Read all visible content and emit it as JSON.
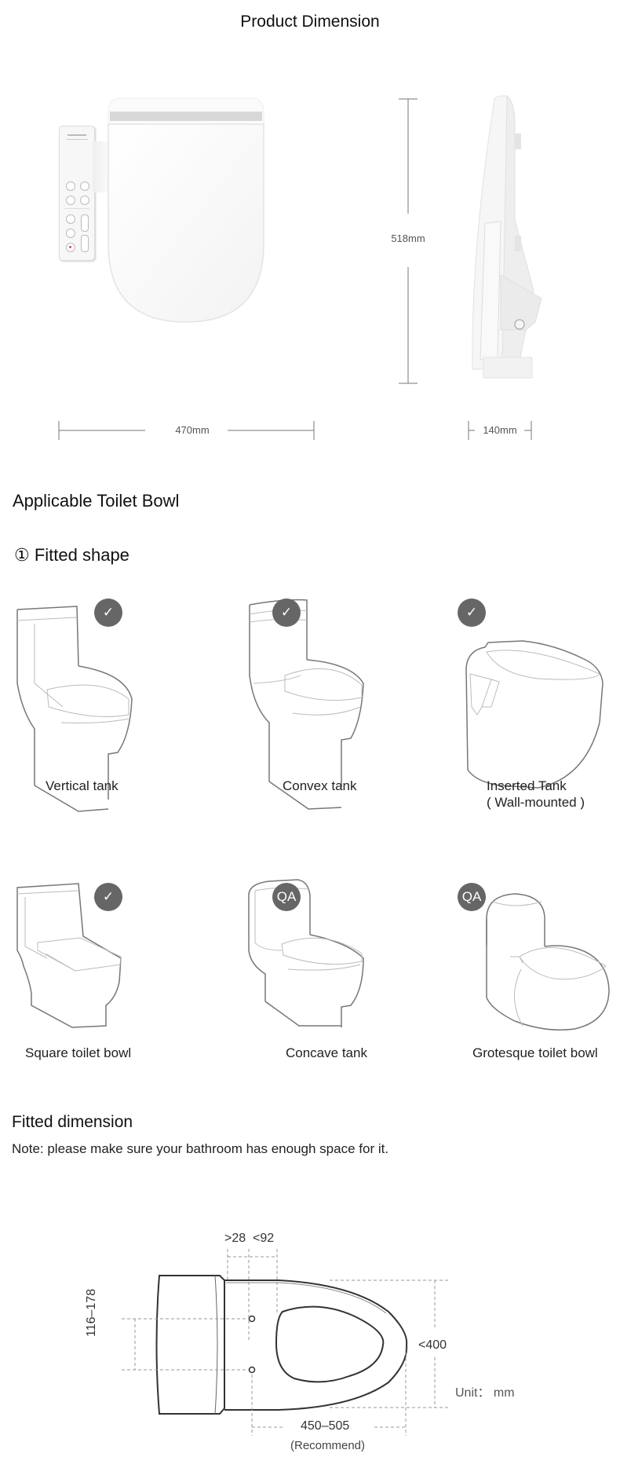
{
  "product_dimension": {
    "title": "Product Dimension",
    "width_label": "470mm",
    "height_label": "518mm",
    "depth_label": "140mm"
  },
  "applicable": {
    "heading": "Applicable Toilet Bowl",
    "subheading": "① Fitted shape",
    "shapes": [
      {
        "name": "Vertical tank",
        "badge": "check",
        "badge_icon": "✓"
      },
      {
        "name": "Convex tank",
        "badge": "check",
        "badge_icon": "✓"
      },
      {
        "name": "Inserted Tank",
        "name_line2": "( Wall-mounted )",
        "badge": "check",
        "badge_icon": "✓"
      },
      {
        "name": "Square toilet bowl",
        "badge": "check",
        "badge_icon": "✓"
      },
      {
        "name": "Concave tank",
        "badge": "qa",
        "badge_icon": "QA"
      },
      {
        "name": "Grotesque toilet bowl",
        "badge": "qa",
        "badge_icon": "QA"
      }
    ],
    "badge_color": "#666666"
  },
  "fitted_dimension": {
    "heading": "Fitted dimension",
    "note": "Note: please make sure your bathroom has enough space for it.",
    "labels": {
      "gap_min": ">28",
      "gap_max": "<92",
      "hole_spacing": "116–178",
      "width_max": "<400",
      "length_range": "450–505",
      "length_note": "(Recommend)",
      "unit": "Unit： mm"
    }
  }
}
